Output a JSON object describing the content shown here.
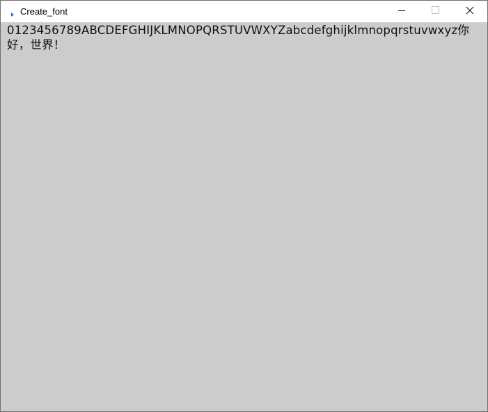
{
  "window": {
    "title": "Create_font",
    "app_icon": "play-triangle-icon",
    "controls": {
      "minimize_icon": "minimize-icon",
      "maximize_icon": "maximize-icon",
      "close_icon": "close-icon"
    }
  },
  "canvas": {
    "background_color": "#cccccc",
    "text": "0123456789ABCDEFGHIJKLMNOPQRSTUVWXYZabcdefghijklmnopqrstuvwxyz你好，世界！"
  },
  "colors": {
    "app_icon": "#1e6fd9",
    "titlebar": "#ffffff",
    "glyph": "#000000"
  }
}
